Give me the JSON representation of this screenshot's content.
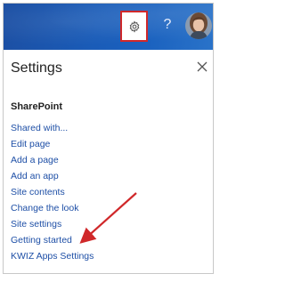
{
  "topbar": {
    "gear_icon": "settings-gear-icon",
    "help_label": "?",
    "avatar_icon": "user-avatar"
  },
  "panel": {
    "title": "Settings",
    "close_icon": "close-icon",
    "section_heading": "SharePoint",
    "items": [
      {
        "label": "Shared with..."
      },
      {
        "label": "Edit page"
      },
      {
        "label": "Add a page"
      },
      {
        "label": "Add an app"
      },
      {
        "label": "Site contents"
      },
      {
        "label": "Change the look"
      },
      {
        "label": "Site settings"
      },
      {
        "label": "Getting started"
      },
      {
        "label": "KWIZ Apps Settings"
      }
    ]
  },
  "colors": {
    "link": "#1e4fa6",
    "highlight": "#d0282a",
    "topbar": "#1a5cb8"
  }
}
